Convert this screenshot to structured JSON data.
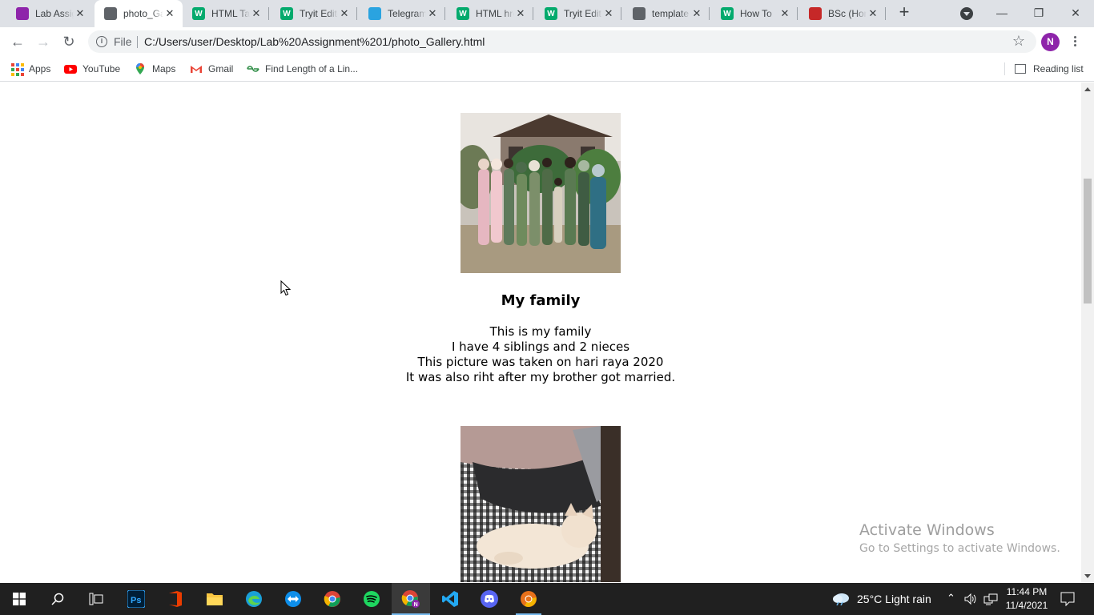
{
  "browser": {
    "tabs": [
      {
        "title": "Lab Assignment",
        "favicon_color": "#8e24aa",
        "favicon_glyph": "",
        "active": false
      },
      {
        "title": "photo_Gallery.html",
        "favicon_color": "#5f6368",
        "favicon_glyph": "",
        "active": true
      },
      {
        "title": "HTML Tags",
        "favicon_color": "#04aa6d",
        "favicon_glyph": "W",
        "active": false
      },
      {
        "title": "Tryit Editor",
        "favicon_color": "#04aa6d",
        "favicon_glyph": "W",
        "active": false
      },
      {
        "title": "Telegram",
        "favicon_color": "#2aa3e0",
        "favicon_glyph": "",
        "active": false
      },
      {
        "title": "HTML href",
        "favicon_color": "#04aa6d",
        "favicon_glyph": "W",
        "active": false
      },
      {
        "title": "Tryit Editor",
        "favicon_color": "#04aa6d",
        "favicon_glyph": "W",
        "active": false
      },
      {
        "title": "template",
        "favicon_color": "#5f6368",
        "favicon_glyph": "",
        "active": false
      },
      {
        "title": "How To",
        "favicon_color": "#04aa6d",
        "favicon_glyph": "W",
        "active": false
      },
      {
        "title": "BSc (Hons)",
        "favicon_color": "#c62828",
        "favicon_glyph": "",
        "active": false
      }
    ],
    "window_controls": {
      "minimize": "—",
      "restore": "❐",
      "close": "✕"
    },
    "toolbar": {
      "site_info_label": "File",
      "url": "C:/Users/user/Desktop/Lab%20Assignment%201/photo_Gallery.html",
      "profile_initial": "N"
    },
    "bookmarks": [
      {
        "label": "Apps",
        "icon": "apps-grid-icon"
      },
      {
        "label": "YouTube",
        "icon": "youtube-icon"
      },
      {
        "label": "Maps",
        "icon": "maps-pin-icon"
      },
      {
        "label": "Gmail",
        "icon": "gmail-icon"
      },
      {
        "label": "Find Length of a Lin...",
        "icon": "geeksforgeeks-icon"
      }
    ],
    "reading_list_label": "Reading list"
  },
  "page": {
    "sections": [
      {
        "title": "My family",
        "lines": [
          "This is my family",
          "I have 4 siblings and 2 nieces",
          "This picture was taken on hari raya 2020",
          "It was also riht after my brother got married."
        ]
      }
    ]
  },
  "watermark": {
    "line1": "Activate Windows",
    "line2": "Go to Settings to activate Windows."
  },
  "taskbar": {
    "weather": "25°C  Light rain",
    "time": "11:44 PM",
    "date": "11/4/2021"
  }
}
